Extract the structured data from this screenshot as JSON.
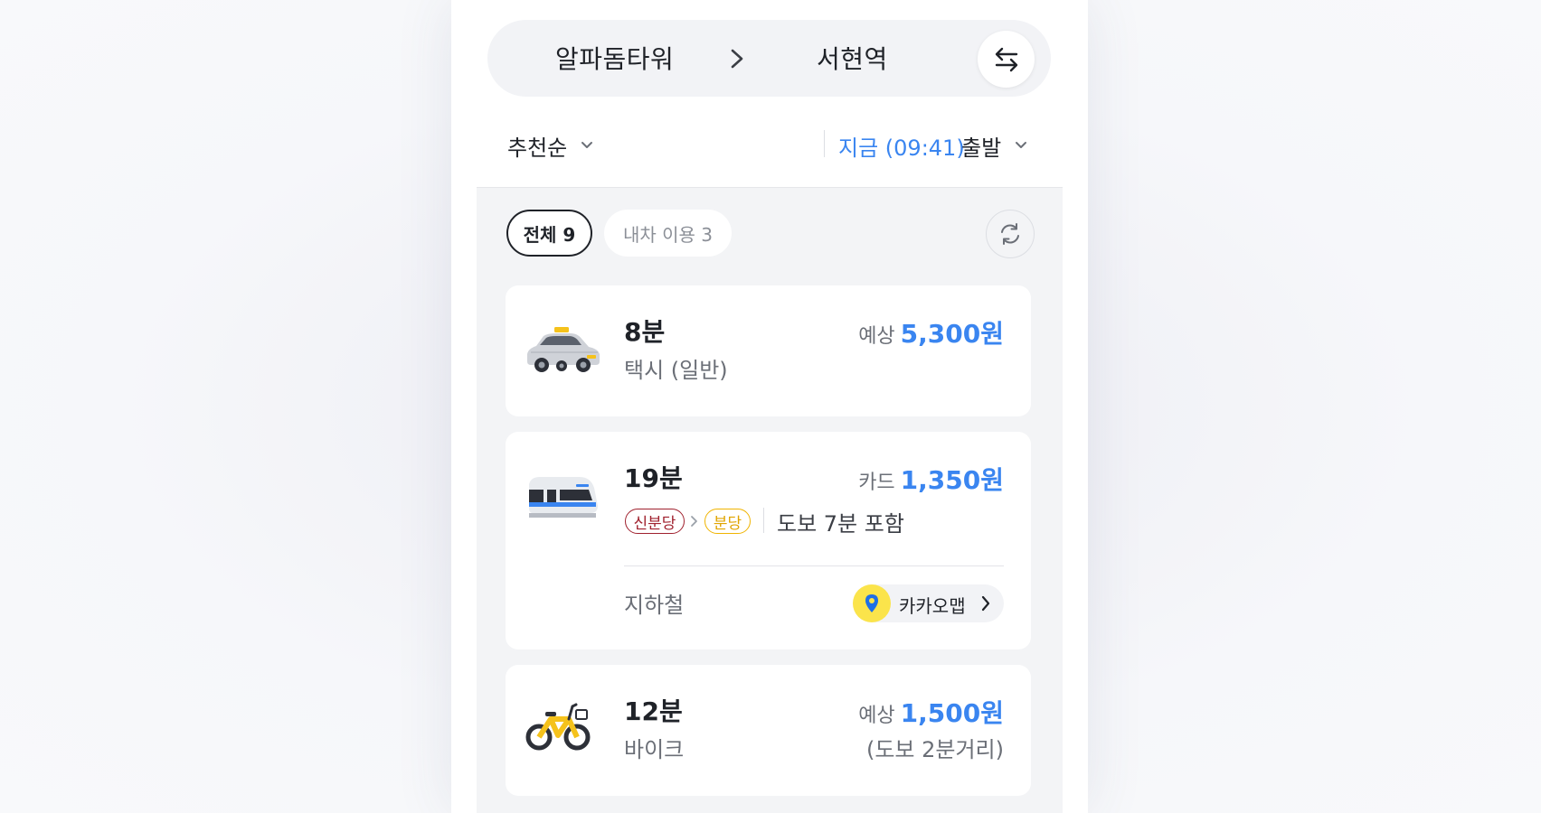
{
  "route": {
    "origin": "알파돔타워",
    "destination": "서현역"
  },
  "sort": {
    "label": "추천순",
    "time_now": "지금 (09:41)",
    "depart": "출발"
  },
  "filters": {
    "all": "전체 9",
    "cars": "내차 이용 3"
  },
  "routes": [
    {
      "mode": "taxi",
      "duration": "8분",
      "subtitle": "택시 (일반)",
      "price_label": "예상",
      "price": "5,300원"
    },
    {
      "mode": "subway",
      "duration": "19분",
      "price_label": "카드",
      "price": "1,350원",
      "lines": [
        {
          "name": "신분당",
          "color": "#a0212e"
        },
        {
          "name": "분당",
          "color": "#f0b400"
        }
      ],
      "walk": "도보 7분 포함",
      "category": "지하철",
      "map_link": "카카오맵"
    },
    {
      "mode": "bike",
      "duration": "12분",
      "subtitle": "바이크",
      "price_label": "예상",
      "price": "1,500원",
      "note": "(도보 2분거리)"
    }
  ],
  "colors": {
    "accent": "#3a85f0",
    "text": "#1f2228",
    "subtext": "#6b6f77"
  },
  "icons": [
    "swap-icon",
    "chevron-right-icon",
    "chevron-down-icon",
    "refresh-icon",
    "taxi-icon",
    "subway-icon",
    "bike-icon",
    "map-pin-icon"
  ]
}
